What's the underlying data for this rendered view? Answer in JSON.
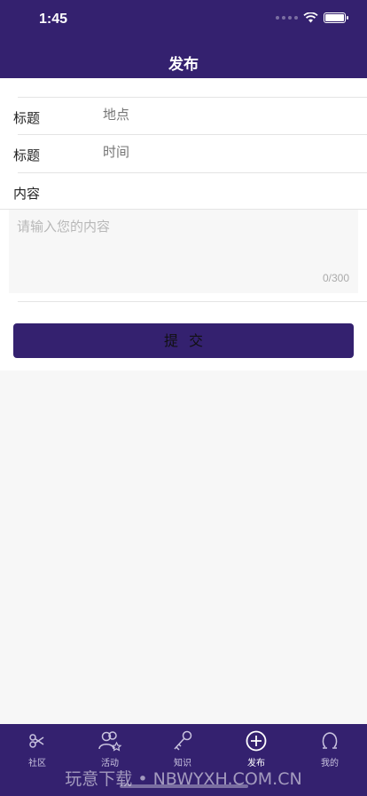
{
  "status_bar": {
    "time": "1:45"
  },
  "nav": {
    "title": "发布"
  },
  "form": {
    "rows": [
      {
        "label": "标题",
        "placeholder": "地点"
      },
      {
        "label": "标题",
        "placeholder": "时间"
      }
    ],
    "content_label": "内容",
    "content_placeholder": "请输入您的内容",
    "char_count": "0/300",
    "submit_label": "提交"
  },
  "tabbar": {
    "items": [
      {
        "label": "社区",
        "icon": "scissors-icon"
      },
      {
        "label": "活动",
        "icon": "people-star-icon"
      },
      {
        "label": "知识",
        "icon": "key-icon"
      },
      {
        "label": "发布",
        "icon": "plus-circle-icon",
        "active": true
      },
      {
        "label": "我的",
        "icon": "person-icon"
      }
    ]
  },
  "watermark": "玩意下载 • NBWYXH.COM.CN",
  "colors": {
    "primary": "#34216f",
    "background": "#f7f7f7"
  }
}
